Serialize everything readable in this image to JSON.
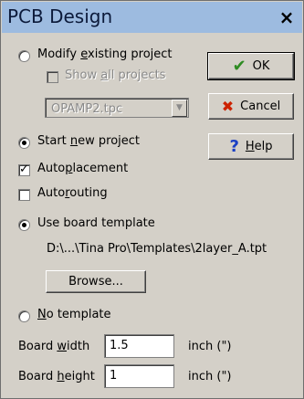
{
  "window": {
    "title": "PCB Design",
    "close_glyph": "×"
  },
  "options": {
    "modify_existing": {
      "label_pre": "Modify ",
      "label_key": "e",
      "label_post": "xisting project"
    },
    "show_all_projects": {
      "label_pre": "Show ",
      "label_key": "a",
      "label_post": "ll projects"
    },
    "project_select": {
      "value": "OPAMP2.tpc"
    },
    "start_new": {
      "label_pre": "Start ",
      "label_key": "n",
      "label_post": "ew project"
    },
    "autoplacement": {
      "label_pre": "Auto",
      "label_key": "p",
      "label_post": "lacement"
    },
    "autorouting": {
      "label_pre": "Auto",
      "label_key": "r",
      "label_post": "outing"
    },
    "use_template": {
      "label": "Use board template"
    },
    "template_path": "D:\\...\\Tina Pro\\Templates\\2layer_A.tpt",
    "browse_button": "Browse...",
    "no_template": {
      "label_key": "N",
      "label_post": "o template"
    }
  },
  "board": {
    "width": {
      "label_pre": "Board ",
      "label_key": "w",
      "label_post": "idth",
      "value": "1.5",
      "unit": "inch (\")"
    },
    "height": {
      "label_pre": "Board ",
      "label_key": "h",
      "label_post": "eight",
      "value": "1",
      "unit": "inch (\")"
    }
  },
  "buttons": {
    "ok": {
      "label": "OK",
      "icon": "checkmark-icon",
      "glyph": "✔",
      "color": "#2e8b22"
    },
    "cancel": {
      "label": "Cancel",
      "icon": "x-mark-icon",
      "glyph": "✖",
      "color": "#cc2200"
    },
    "help": {
      "label_key": "H",
      "label_post": "elp",
      "icon": "question-icon",
      "glyph": "?",
      "color": "#1a3fc4"
    }
  }
}
